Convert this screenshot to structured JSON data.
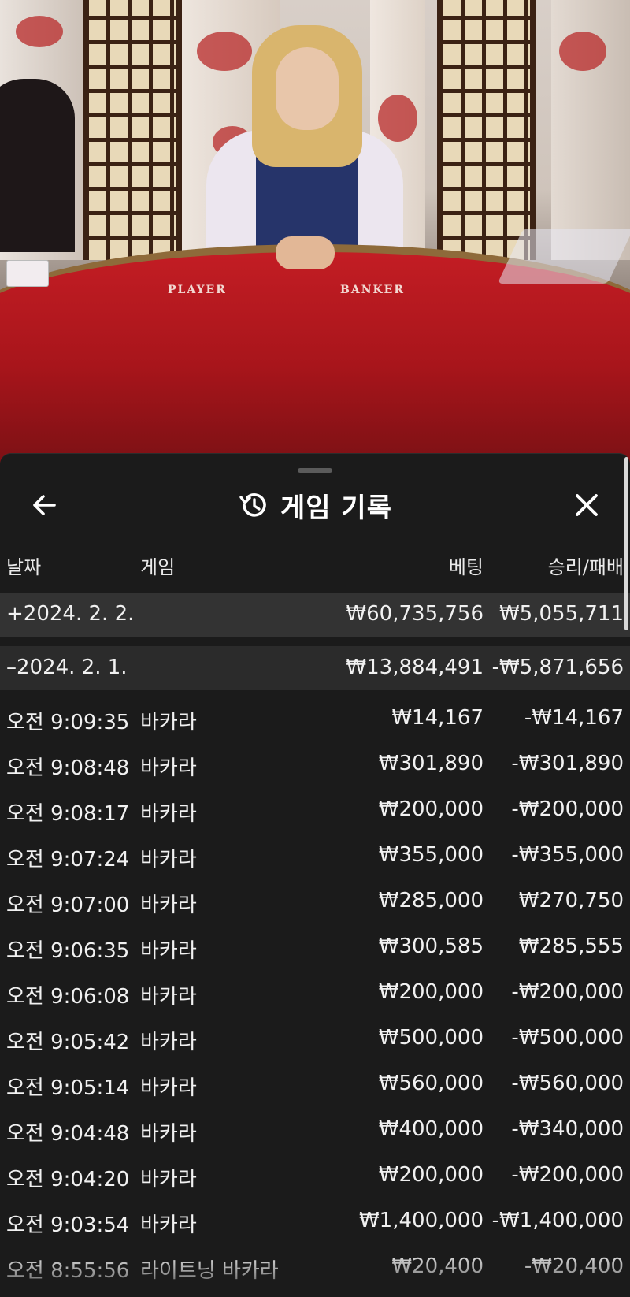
{
  "sheet": {
    "title": "게임 기록",
    "icons": {
      "back": "arrow-left-icon",
      "history": "history-icon",
      "close": "close-icon"
    }
  },
  "columns": {
    "date": "날짜",
    "game": "게임",
    "bet": "베팅",
    "result": "승리/패배"
  },
  "day_groups": [
    {
      "toggle": "+",
      "date": "2024. 2. 2.",
      "bet": "₩60,735,756",
      "result": "₩5,055,711"
    },
    {
      "toggle": "–",
      "date": "2024. 2. 1.",
      "bet": "₩13,884,491",
      "result": "-₩5,871,656"
    }
  ],
  "transactions": [
    {
      "time": "오전 9:09:35",
      "game": "바카라",
      "bet": "₩14,167",
      "result": "-₩14,167"
    },
    {
      "time": "오전 9:08:48",
      "game": "바카라",
      "bet": "₩301,890",
      "result": "-₩301,890"
    },
    {
      "time": "오전 9:08:17",
      "game": "바카라",
      "bet": "₩200,000",
      "result": "-₩200,000"
    },
    {
      "time": "오전 9:07:24",
      "game": "바카라",
      "bet": "₩355,000",
      "result": "-₩355,000"
    },
    {
      "time": "오전 9:07:00",
      "game": "바카라",
      "bet": "₩285,000",
      "result": "₩270,750"
    },
    {
      "time": "오전 9:06:35",
      "game": "바카라",
      "bet": "₩300,585",
      "result": "₩285,555"
    },
    {
      "time": "오전 9:06:08",
      "game": "바카라",
      "bet": "₩200,000",
      "result": "-₩200,000"
    },
    {
      "time": "오전 9:05:42",
      "game": "바카라",
      "bet": "₩500,000",
      "result": "-₩500,000"
    },
    {
      "time": "오전 9:05:14",
      "game": "바카라",
      "bet": "₩560,000",
      "result": "-₩560,000"
    },
    {
      "time": "오전 9:04:48",
      "game": "바카라",
      "bet": "₩400,000",
      "result": "-₩340,000"
    },
    {
      "time": "오전 9:04:20",
      "game": "바카라",
      "bet": "₩200,000",
      "result": "-₩200,000"
    },
    {
      "time": "오전 9:03:54",
      "game": "바카라",
      "bet": "₩1,400,000",
      "result": "-₩1,400,000"
    },
    {
      "time": "오전 8:55:56",
      "game": "라이트닝 바카라",
      "bet": "₩20,400",
      "result": "-₩20,400"
    }
  ],
  "video": {
    "felt_labels": {
      "player": "PLAYER",
      "banker": "BANKER"
    },
    "colors": {
      "felt": "#c31d24",
      "vest": "#26346a",
      "lattice": "#3b2214"
    }
  }
}
